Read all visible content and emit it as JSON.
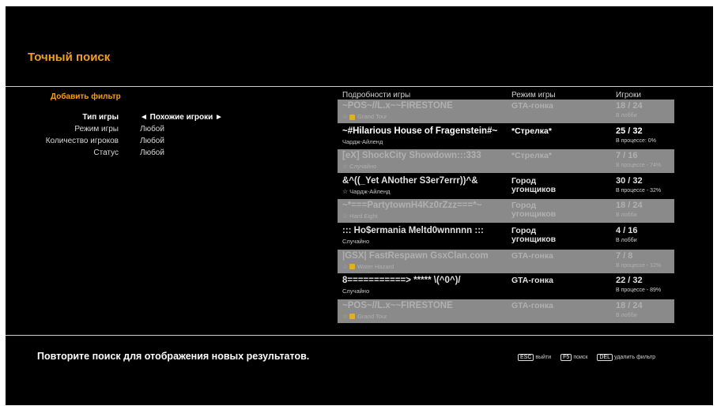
{
  "title": "Точный поиск",
  "filters": {
    "add_filter": "Добавить фильтр",
    "items": [
      {
        "label": "Тип игры",
        "value": "◄ Похожие игроки ►"
      },
      {
        "label": "Режим игры",
        "value": "Любой"
      },
      {
        "label": "Количество игроков",
        "value": "Любой"
      },
      {
        "label": "Статус",
        "value": "Любой"
      }
    ]
  },
  "table": {
    "headers": {
      "details": "Подробности игры",
      "mode": "Режим игры",
      "players": "Игроки"
    },
    "rows": [
      {
        "name": "~POS~//L.x~~FIRESTONE",
        "sub": "Grand Tour",
        "mode": "GTA-гонка",
        "players": "18 / 24",
        "status": "В лобби"
      },
      {
        "name": "~#Hilarious House of Fragenstein#~",
        "sub": "Чардж-Айленд",
        "mode": "*Стрелка*",
        "players": "25 / 32",
        "status": "В процессе: 0%"
      },
      {
        "name": "[eX] ShockCity Showdown:::333",
        "sub": "Случайно",
        "mode": "*Стрелка*",
        "players": "7 / 16",
        "status": "В процессе - 74%"
      },
      {
        "name": "&^((_Yet ANother S3er7errr))^&",
        "sub": "Чардж-Айленд",
        "mode": "Город угонщиков",
        "players": "30 / 32",
        "status": "В процессе - 32%"
      },
      {
        "name": "~*===PartytownH4Kz0rZzz===*~",
        "sub": "Hard Eight",
        "mode": "Город угонщиков",
        "players": "18 / 24",
        "status": "В лобби"
      },
      {
        "name": "::: Ho$ermania Meltd0wnnnnn :::",
        "sub": "Случайно",
        "mode": "Город угонщиков",
        "players": "4 / 16",
        "status": "В лобби"
      },
      {
        "name": "|GSX| FastRespawn GsxClan.com",
        "sub": "Water Hazard",
        "mode": "GTA-гонка",
        "players": "7 / 8",
        "status": "В процессе - 12%"
      },
      {
        "name": "8===========> ***** \\(^0^)/",
        "sub": "Случайно",
        "mode": "GTA-гонка",
        "players": "22 / 32",
        "status": "В процессе - 89%"
      },
      {
        "name": "~POS~//L.x~~FIRESTONE",
        "sub": "Grand Tour",
        "mode": "GTA-гонка",
        "players": "18 / 24",
        "status": "В лобби"
      }
    ]
  },
  "footer": {
    "message": "Повторите поиск для отображения новых результатов.",
    "hints": [
      {
        "key": "ESC",
        "label": "выйти"
      },
      {
        "key": "F5",
        "label": "поиск"
      },
      {
        "key": "DEL",
        "label": "удалить фильтр"
      }
    ]
  }
}
